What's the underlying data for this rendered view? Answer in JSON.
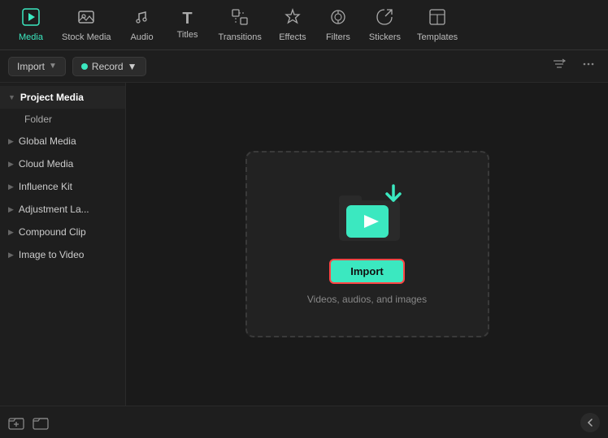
{
  "nav": {
    "items": [
      {
        "id": "media",
        "label": "Media",
        "icon": "▶",
        "active": true
      },
      {
        "id": "stock-media",
        "label": "Stock Media",
        "icon": "🎞",
        "active": false
      },
      {
        "id": "audio",
        "label": "Audio",
        "icon": "♪",
        "active": false
      },
      {
        "id": "titles",
        "label": "Titles",
        "icon": "T",
        "active": false
      },
      {
        "id": "transitions",
        "label": "Transitions",
        "icon": "▦",
        "active": false
      },
      {
        "id": "effects",
        "label": "Effects",
        "icon": "✦",
        "active": false
      },
      {
        "id": "filters",
        "label": "Filters",
        "icon": "◎",
        "active": false
      },
      {
        "id": "stickers",
        "label": "Stickers",
        "icon": "☆",
        "active": false
      },
      {
        "id": "templates",
        "label": "Templates",
        "icon": "⊡",
        "active": false
      }
    ]
  },
  "toolbar": {
    "import_label": "Import",
    "record_label": "Record",
    "filter_icon": "≡↑",
    "more_icon": "···"
  },
  "sidebar": {
    "items": [
      {
        "id": "project-media",
        "label": "Project Media",
        "active": true,
        "has_arrow": true
      },
      {
        "id": "folder",
        "label": "Folder",
        "active": false,
        "is_sub": true
      },
      {
        "id": "global-media",
        "label": "Global Media",
        "active": false,
        "has_arrow": true
      },
      {
        "id": "cloud-media",
        "label": "Cloud Media",
        "active": false,
        "has_arrow": true
      },
      {
        "id": "influence-kit",
        "label": "Influence Kit",
        "active": false,
        "has_arrow": true
      },
      {
        "id": "adjustment-la",
        "label": "Adjustment La...",
        "active": false,
        "has_arrow": true
      },
      {
        "id": "compound-clip",
        "label": "Compound Clip",
        "active": false,
        "has_arrow": true
      },
      {
        "id": "image-to-video",
        "label": "Image to Video",
        "active": false,
        "has_arrow": true
      }
    ]
  },
  "dropzone": {
    "import_btn_label": "Import",
    "hint_text": "Videos, audios, and images"
  },
  "bottom": {
    "new_folder_icon": "📁",
    "folder_icon": "🗂"
  }
}
